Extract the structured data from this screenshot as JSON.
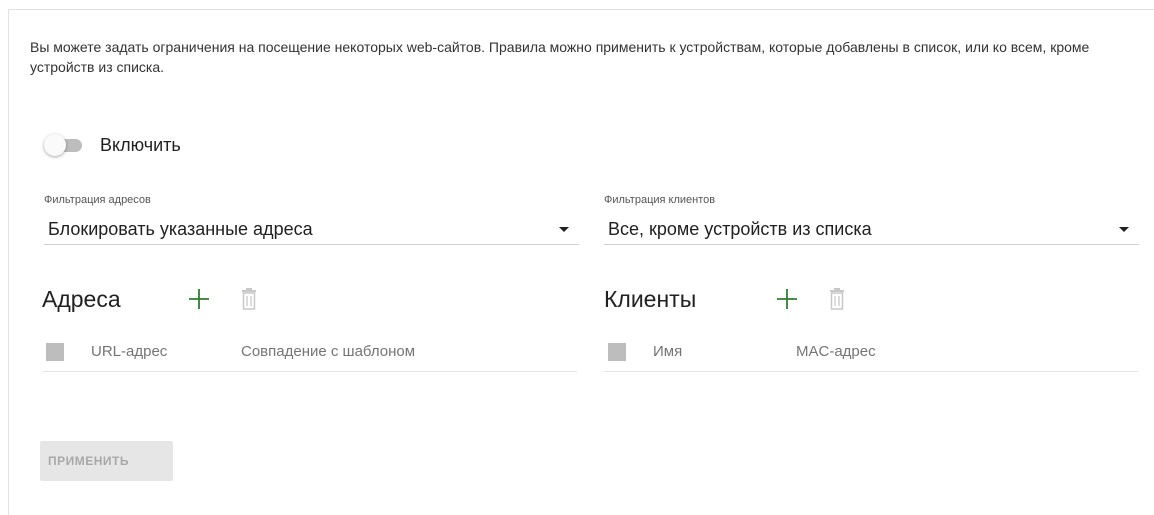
{
  "description": "Вы можете задать ограничения на посещение некоторых web-сайтов. Правила можно применить к устройствам, которые добавлены в список, или ко всем, кроме устройств из списка.",
  "enable": {
    "label": "Включить",
    "state": "off"
  },
  "address_filter": {
    "caption": "Фильтрация адресов",
    "value": "Блокировать указанные адреса"
  },
  "client_filter": {
    "caption": "Фильтрация клиентов",
    "value": "Все, кроме устройств из списка"
  },
  "addresses": {
    "title": "Адреса",
    "columns": [
      "URL-адрес",
      "Совпадение с шаблоном"
    ]
  },
  "clients": {
    "title": "Клиенты",
    "columns": [
      "Имя",
      "MAC-адрес"
    ]
  },
  "apply_label": "ПРИМЕНИТЬ",
  "colors": {
    "add_icon": "#2e7d32",
    "delete_icon_disabled": "#c8c8c8",
    "checkbox": "#bdbdbd",
    "apply_bg_disabled": "#e6e6e6",
    "apply_text_disabled": "#a8a8a8"
  },
  "icons": {
    "add": "plus-icon",
    "delete": "trash-icon",
    "dropdown": "caret-down-icon"
  }
}
